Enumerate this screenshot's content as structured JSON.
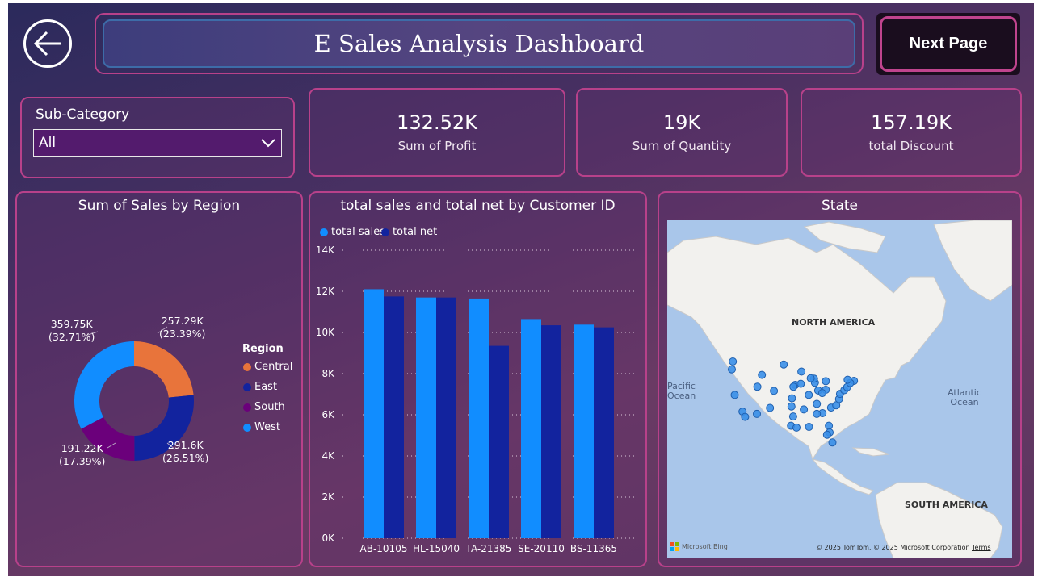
{
  "header": {
    "title": "E Sales Analysis Dashboard",
    "next_button": "Next Page",
    "back_icon": "arrow-left-icon"
  },
  "slicer": {
    "title": "Sub-Category",
    "selected": "All",
    "icon": "chevron-down-icon"
  },
  "kpis": [
    {
      "value": "132.52K",
      "label": "Sum of Profit"
    },
    {
      "value": "19K",
      "label": "Sum of Quantity"
    },
    {
      "value": "157.19K",
      "label": "total Discount"
    }
  ],
  "colors": {
    "central": "#e8743b",
    "east": "#12239e",
    "south": "#6b007b",
    "west": "#118dff",
    "total_sales": "#118dff",
    "total_net": "#12239e",
    "accent_border": "#b8418a"
  },
  "chart_data": [
    {
      "type": "pie",
      "title": "Sum of Sales by Region",
      "legend_title": "Region",
      "legend_position": "right",
      "categories": [
        "Central",
        "East",
        "South",
        "West"
      ],
      "values": [
        257.29,
        291.6,
        191.22,
        359.75
      ],
      "unit": "K",
      "data_labels": [
        {
          "value": "257.29K",
          "pct": "(23.39%)"
        },
        {
          "value": "291.6K",
          "pct": "(26.51%)"
        },
        {
          "value": "191.22K",
          "pct": "(17.39%)"
        },
        {
          "value": "359.75K",
          "pct": "(32.71%)"
        }
      ]
    },
    {
      "type": "bar",
      "title": "total sales and total net by Customer ID",
      "legend_position": "top-left",
      "categories": [
        "AB-10105",
        "HL-15040",
        "TA-21385",
        "SE-20110",
        "BS-11365"
      ],
      "series": [
        {
          "name": "total sales",
          "values": [
            12100,
            11700,
            11650,
            10650,
            10380
          ]
        },
        {
          "name": "total net",
          "values": [
            11750,
            11700,
            9350,
            10350,
            10250
          ]
        }
      ],
      "ylim": [
        0,
        14000
      ],
      "yticks": [
        "0K",
        "2K",
        "4K",
        "6K",
        "8K",
        "10K",
        "12K",
        "14K"
      ],
      "grid": true
    }
  ],
  "map": {
    "title": "State",
    "labels": {
      "north_america": "NORTH AMERICA",
      "south_america": "SOUTH AMERICA",
      "pacific": "Pacific Ocean",
      "atlantic": "Atlantic Ocean"
    },
    "bing_logo": "Microsoft Bing",
    "copyright": "© 2025 TomTom, © 2025 Microsoft Corporation",
    "terms": "Terms",
    "points": [
      [
        -122.3,
        47.6
      ],
      [
        -122.7,
        45.5
      ],
      [
        -121.5,
        38.6
      ],
      [
        -118.2,
        34.1
      ],
      [
        -117.1,
        32.7
      ],
      [
        -112.1,
        33.5
      ],
      [
        -111.9,
        40.8
      ],
      [
        -104.9,
        39.7
      ],
      [
        -106.6,
        35.1
      ],
      [
        -97.7,
        30.3
      ],
      [
        -96.8,
        32.8
      ],
      [
        -95.4,
        29.8
      ],
      [
        -97.5,
        35.5
      ],
      [
        -97.3,
        37.7
      ],
      [
        -95.9,
        41.3
      ],
      [
        -93.3,
        44.9
      ],
      [
        -93.6,
        41.6
      ],
      [
        -90.2,
        38.6
      ],
      [
        -87.6,
        41.9
      ],
      [
        -86.2,
        39.8
      ],
      [
        -83.0,
        40.0
      ],
      [
        -84.4,
        33.7
      ],
      [
        -86.8,
        36.2
      ],
      [
        -90.1,
        30.0
      ],
      [
        -81.7,
        30.3
      ],
      [
        -81.4,
        28.5
      ],
      [
        -80.2,
        25.8
      ],
      [
        -80.8,
        35.2
      ],
      [
        -78.6,
        35.8
      ],
      [
        -77.4,
        37.5
      ],
      [
        -77.0,
        38.9
      ],
      [
        -75.2,
        39.9
      ],
      [
        -74.0,
        40.7
      ],
      [
        -71.1,
        42.4
      ],
      [
        -72.7,
        41.8
      ],
      [
        -83.0,
        42.3
      ],
      [
        -88.0,
        43.0
      ],
      [
        -89.4,
        43.1
      ],
      [
        -92.3,
        34.7
      ],
      [
        -86.8,
        33.5
      ],
      [
        -84.5,
        39.1
      ],
      [
        -82.5,
        27.9
      ],
      [
        -73.8,
        42.7
      ],
      [
        -96.7,
        40.8
      ],
      [
        -100.8,
        46.8
      ],
      [
        -110.0,
        44.0
      ]
    ]
  }
}
